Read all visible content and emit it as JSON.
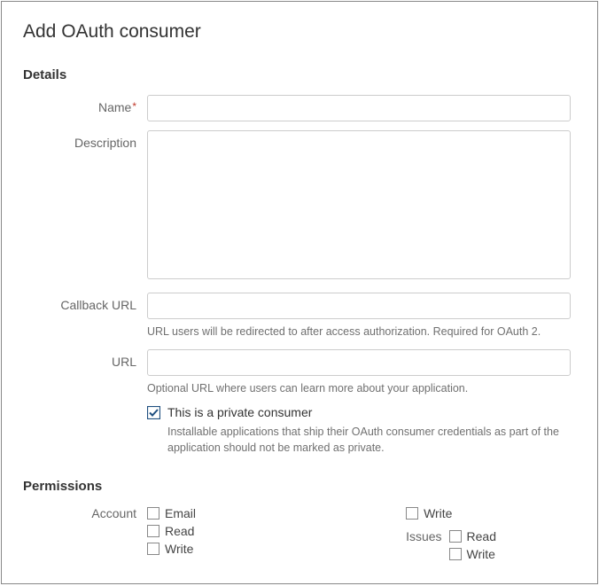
{
  "pageTitle": "Add OAuth consumer",
  "sections": {
    "details": {
      "heading": "Details",
      "name": {
        "label": "Name",
        "required": true,
        "value": ""
      },
      "description": {
        "label": "Description",
        "value": ""
      },
      "callback": {
        "label": "Callback URL",
        "value": "",
        "help": "URL users will be redirected to after access authorization. Required for OAuth 2."
      },
      "url": {
        "label": "URL",
        "value": "",
        "help": "Optional URL where users can learn more about your application."
      },
      "privateConsumer": {
        "checked": true,
        "label": "This is a private consumer",
        "help": "Installable applications that ship their OAuth consumer credentials as part of the application should not be marked as private."
      }
    },
    "permissions": {
      "heading": "Permissions",
      "account": {
        "label": "Account",
        "options": [
          {
            "key": "email",
            "label": "Email",
            "checked": false
          },
          {
            "key": "read",
            "label": "Read",
            "checked": false
          },
          {
            "key": "write",
            "label": "Write",
            "checked": false
          }
        ]
      },
      "col2top": {
        "options": [
          {
            "key": "write-top",
            "label": "Write",
            "checked": false
          }
        ]
      },
      "issues": {
        "label": "Issues",
        "options": [
          {
            "key": "read",
            "label": "Read",
            "checked": false
          },
          {
            "key": "write",
            "label": "Write",
            "checked": false
          }
        ]
      }
    }
  }
}
